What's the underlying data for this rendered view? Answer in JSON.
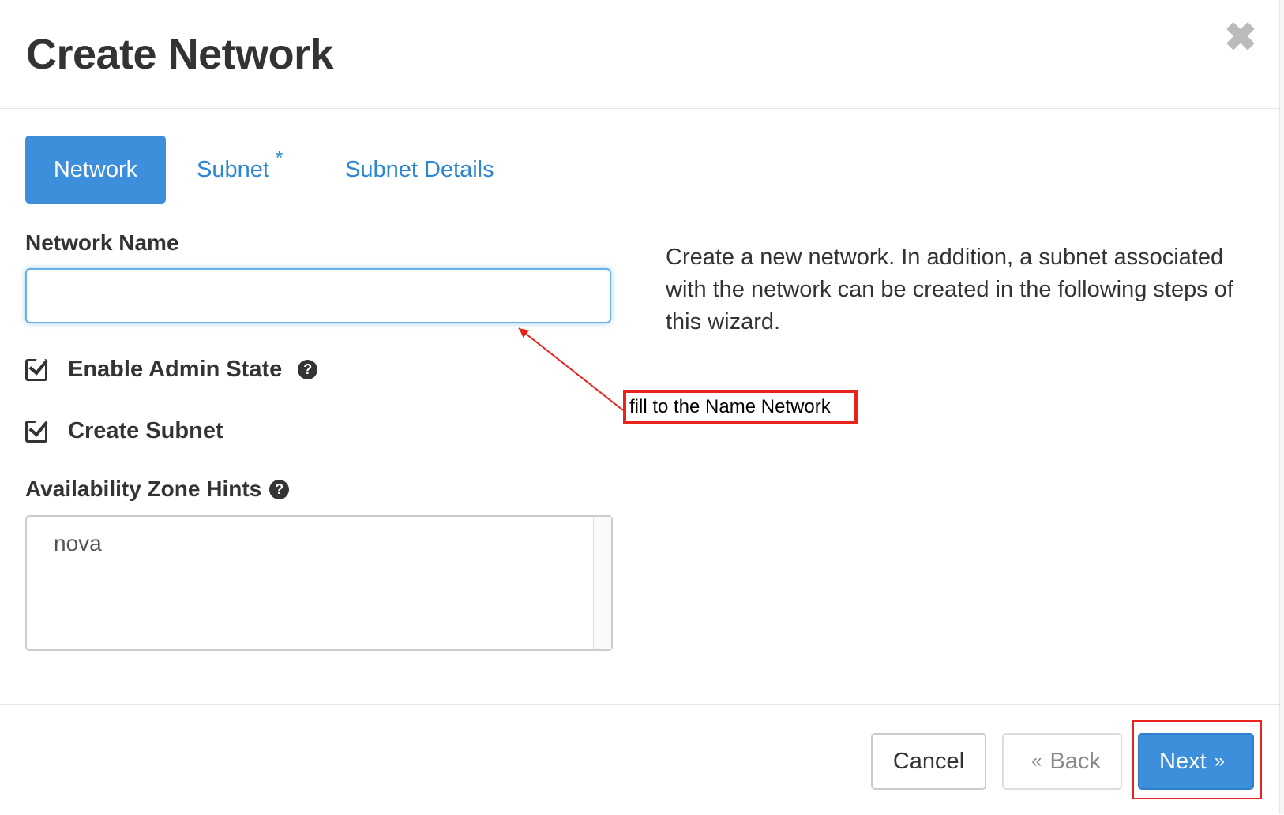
{
  "dialog": {
    "title": "Create Network",
    "close_glyph": "✖"
  },
  "tabs": [
    {
      "label": "Network",
      "active": true
    },
    {
      "label": "Subnet",
      "required_mark": "*",
      "active": false
    },
    {
      "label": "Subnet Details",
      "active": false
    }
  ],
  "form": {
    "network_name_label": "Network Name",
    "network_name_value": "",
    "enable_admin_state": {
      "label": "Enable Admin State",
      "checked": true,
      "help_glyph": "?"
    },
    "create_subnet": {
      "label": "Create Subnet",
      "checked": true
    },
    "availability_zone_hints": {
      "label": "Availability Zone Hints",
      "help_glyph": "?",
      "options": [
        "nova"
      ]
    }
  },
  "description": "Create a new network. In addition, a subnet associated with the network can be created in the following steps of this wizard.",
  "annotation": {
    "text": "fill to the Name  Network",
    "color": "#e8231b"
  },
  "footer": {
    "cancel_label": "Cancel",
    "back_prefix": "«",
    "back_label": "Back",
    "next_label": "Next",
    "next_suffix": "»"
  },
  "colors": {
    "primary": "#3e8fdb",
    "link": "#2c86d2",
    "annotation_red": "#e8231b",
    "focus_border": "#66afe9"
  }
}
